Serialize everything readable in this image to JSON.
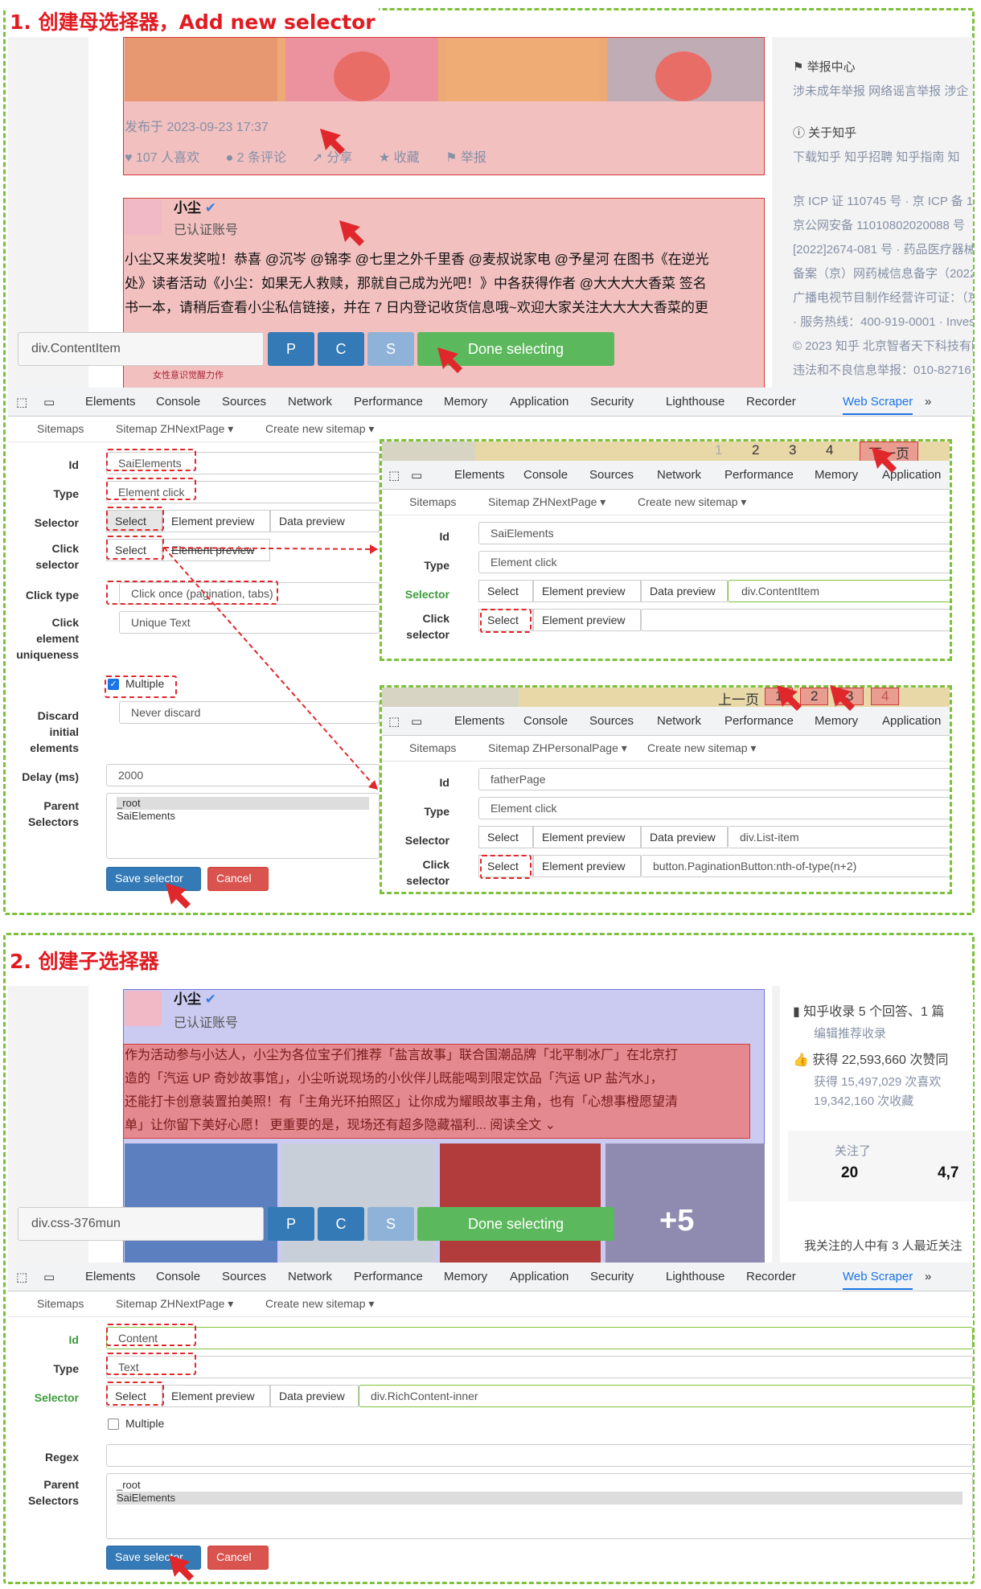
{
  "step1": {
    "title": "1. 创建母选择器，Add new selector"
  },
  "step2": {
    "title": "2. 创建子选择器"
  },
  "feed1": {
    "post_time": "发布于 2023-09-23 17:37",
    "likes": "107 人喜欢",
    "comments": "2 条评论",
    "share": "分享",
    "favorite": "收藏",
    "report": "举报",
    "author": "小尘",
    "verified": "已认证账号",
    "text_lines": [
      "小尘又来发奖啦！恭喜 @沉岑 @锦李 @七里之外千里香 @麦叔说家电 @予星河 在图书《在逆光",
      "处》读者活动《小尘：如果无人救赎，那就自己成为光吧！》中各获得作者 @大大大大香菜 签名",
      "书一本，请稍后查看小尘私信链接，并在 7 日内登记收货信息哦~欢迎大家关注大大大大香菜的更"
    ],
    "image_caption": "女性意识觉醒力作"
  },
  "sidebar1": {
    "report_center": "举报中心",
    "report_links": "涉未成年举报  网络谣言举报  涉企",
    "about": "关于知乎",
    "about_links": "下载知乎  知乎招聘  知乎指南  知",
    "icp_lines": [
      "京 ICP 证 110745 号 · 京 ICP 备 13",
      "京公网安备 11010802020088 号",
      "[2022]2674-081 号 · 药品医疗器械",
      "备案（京）网药械信息备字（2022）",
      "广播电视节目制作经营许可证：（京）",
      "· 服务热线：400-919-0001 · Inves",
      "© 2023 知乎 北京智者天下科技有限",
      "违法和不良信息举报：010-82716"
    ]
  },
  "picker1": {
    "selector": "div.ContentItem",
    "p": "P",
    "c": "C",
    "s": "S",
    "done": "Done selecting"
  },
  "picker2": {
    "selector": "div.css-376mun",
    "p": "P",
    "c": "C",
    "s": "S",
    "done": "Done selecting"
  },
  "devtools": {
    "tabs": [
      "Elements",
      "Console",
      "Sources",
      "Network",
      "Performance",
      "Memory",
      "Application",
      "Security",
      "Lighthouse",
      "Recorder",
      "Web Scraper"
    ],
    "more": "»",
    "subtabs": [
      "Sitemaps",
      "Sitemap ZHNextPage ▾",
      "Create new sitemap ▾"
    ]
  },
  "form1": {
    "labels": {
      "id": "Id",
      "type": "Type",
      "selector": "Selector",
      "click_selector": "Click selector",
      "click_type": "Click type",
      "click_uniqueness": "Click element uniqueness",
      "discard": "Discard initial elements",
      "delay": "Delay (ms)",
      "parent": "Parent Selectors"
    },
    "id_value": "SaiElements",
    "type_value": "Element click",
    "select": "Select",
    "element_preview": "Element preview",
    "data_preview": "Data preview",
    "click_type_value": "Click once (pagination, tabs)",
    "uniqueness_value": "Unique Text",
    "multiple": "Multiple",
    "discard_value": "Never discard",
    "delay_value": "2000",
    "parents": [
      "_root",
      "SaiElements"
    ],
    "save": "Save selector",
    "cancel": "Cancel"
  },
  "inset1": {
    "pager": [
      "1",
      "2",
      "3",
      "4",
      "下一页"
    ],
    "tabs": [
      "Elements",
      "Console",
      "Sources",
      "Network",
      "Performance",
      "Memory",
      "Application"
    ],
    "subtabs": [
      "Sitemaps",
      "Sitemap ZHNextPage ▾",
      "Create new sitemap ▾"
    ],
    "id_value": "SaiElements",
    "type_value": "Element click",
    "selector_value": "div.ContentItem",
    "labels": {
      "id": "Id",
      "type": "Type",
      "selector": "Selector",
      "click_selector": "Click selector"
    },
    "select": "Select",
    "element_preview": "Element preview",
    "data_preview": "Data preview"
  },
  "inset2": {
    "pager": [
      "上一页",
      "1",
      "2",
      "3",
      "4"
    ],
    "tabs": [
      "Elements",
      "Console",
      "Sources",
      "Network",
      "Performance",
      "Memory",
      "Application"
    ],
    "subtabs": [
      "Sitemaps",
      "Sitemap ZHPersonalPage ▾",
      "Create new sitemap ▾"
    ],
    "id_value": "fatherPage",
    "type_value": "Element click",
    "selector_value": "div.List-item",
    "click_value": "button.PaginationButton:nth-of-type(n+2)",
    "labels": {
      "id": "Id",
      "type": "Type",
      "selector": "Selector",
      "click_selector": "Click selector"
    },
    "select": "Select",
    "element_preview": "Element preview",
    "data_preview": "Data preview"
  },
  "feed2": {
    "author": "小尘",
    "verified": "已认证账号",
    "text_lines": [
      "作为活动参与小达人，小尘为各位宝子们推荐「盐言故事」联合国潮品牌「北平制冰厂」在北京打",
      "造的「汽运 UP 奇妙故事馆」，小尘听说现场的小伙伴儿既能喝到限定饮品「汽运 UP 盐汽水」，",
      "还能打卡创意装置拍美照！有「主角光环拍照区」让你成为耀眼故事主角，也有「心想事橙愿望清",
      "单」让你留下美好心愿！ 更重要的是，现场还有超多隐藏福利... 阅读全文 ⌄"
    ],
    "more_images": "+5"
  },
  "sidebar2": {
    "collected": "知乎收录 5 个回答、1 篇",
    "collected_sub": "编辑推荐收录",
    "likes": "获得 22,593,660 次赞同",
    "likes_sub1": "获得 15,497,029 次喜欢",
    "likes_sub2": "19,342,160 次收藏",
    "following_label": "关注了",
    "following_value": "20",
    "followers_value": "4,7",
    "follow_note": "我关注的人中有 3 人最近关注"
  },
  "form2": {
    "labels": {
      "id": "Id",
      "type": "Type",
      "selector": "Selector",
      "regex": "Regex",
      "parent": "Parent Selectors"
    },
    "id_value": "Content",
    "type_value": "Text",
    "select": "Select",
    "element_preview": "Element preview",
    "data_preview": "Data preview",
    "selector_value": "div.RichContent-inner",
    "multiple": "Multiple",
    "parents": [
      "_root",
      "SaiElements"
    ],
    "save": "Save selector",
    "cancel": "Cancel"
  },
  "colors": {
    "accent_green": "#7dc13b",
    "annotation_red": "#e11b22",
    "button_blue": "#337ab7",
    "done_green": "#5cb85c",
    "cancel_red": "#d9534f"
  }
}
